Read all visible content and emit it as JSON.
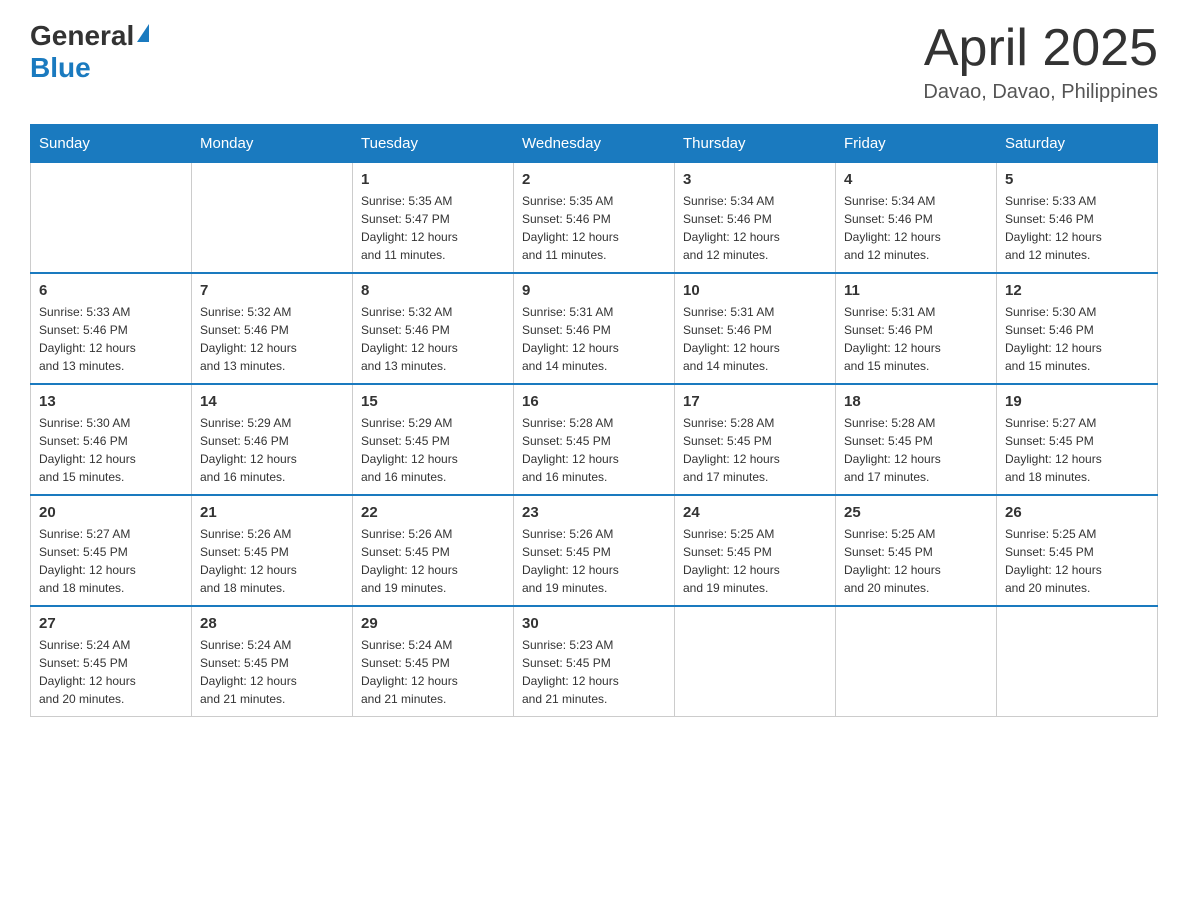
{
  "header": {
    "logo_general": "General",
    "logo_blue": "Blue",
    "month_year": "April 2025",
    "location": "Davao, Davao, Philippines"
  },
  "weekdays": [
    "Sunday",
    "Monday",
    "Tuesday",
    "Wednesday",
    "Thursday",
    "Friday",
    "Saturday"
  ],
  "weeks": [
    [
      {
        "day": "",
        "info": ""
      },
      {
        "day": "",
        "info": ""
      },
      {
        "day": "1",
        "info": "Sunrise: 5:35 AM\nSunset: 5:47 PM\nDaylight: 12 hours\nand 11 minutes."
      },
      {
        "day": "2",
        "info": "Sunrise: 5:35 AM\nSunset: 5:46 PM\nDaylight: 12 hours\nand 11 minutes."
      },
      {
        "day": "3",
        "info": "Sunrise: 5:34 AM\nSunset: 5:46 PM\nDaylight: 12 hours\nand 12 minutes."
      },
      {
        "day": "4",
        "info": "Sunrise: 5:34 AM\nSunset: 5:46 PM\nDaylight: 12 hours\nand 12 minutes."
      },
      {
        "day": "5",
        "info": "Sunrise: 5:33 AM\nSunset: 5:46 PM\nDaylight: 12 hours\nand 12 minutes."
      }
    ],
    [
      {
        "day": "6",
        "info": "Sunrise: 5:33 AM\nSunset: 5:46 PM\nDaylight: 12 hours\nand 13 minutes."
      },
      {
        "day": "7",
        "info": "Sunrise: 5:32 AM\nSunset: 5:46 PM\nDaylight: 12 hours\nand 13 minutes."
      },
      {
        "day": "8",
        "info": "Sunrise: 5:32 AM\nSunset: 5:46 PM\nDaylight: 12 hours\nand 13 minutes."
      },
      {
        "day": "9",
        "info": "Sunrise: 5:31 AM\nSunset: 5:46 PM\nDaylight: 12 hours\nand 14 minutes."
      },
      {
        "day": "10",
        "info": "Sunrise: 5:31 AM\nSunset: 5:46 PM\nDaylight: 12 hours\nand 14 minutes."
      },
      {
        "day": "11",
        "info": "Sunrise: 5:31 AM\nSunset: 5:46 PM\nDaylight: 12 hours\nand 15 minutes."
      },
      {
        "day": "12",
        "info": "Sunrise: 5:30 AM\nSunset: 5:46 PM\nDaylight: 12 hours\nand 15 minutes."
      }
    ],
    [
      {
        "day": "13",
        "info": "Sunrise: 5:30 AM\nSunset: 5:46 PM\nDaylight: 12 hours\nand 15 minutes."
      },
      {
        "day": "14",
        "info": "Sunrise: 5:29 AM\nSunset: 5:46 PM\nDaylight: 12 hours\nand 16 minutes."
      },
      {
        "day": "15",
        "info": "Sunrise: 5:29 AM\nSunset: 5:45 PM\nDaylight: 12 hours\nand 16 minutes."
      },
      {
        "day": "16",
        "info": "Sunrise: 5:28 AM\nSunset: 5:45 PM\nDaylight: 12 hours\nand 16 minutes."
      },
      {
        "day": "17",
        "info": "Sunrise: 5:28 AM\nSunset: 5:45 PM\nDaylight: 12 hours\nand 17 minutes."
      },
      {
        "day": "18",
        "info": "Sunrise: 5:28 AM\nSunset: 5:45 PM\nDaylight: 12 hours\nand 17 minutes."
      },
      {
        "day": "19",
        "info": "Sunrise: 5:27 AM\nSunset: 5:45 PM\nDaylight: 12 hours\nand 18 minutes."
      }
    ],
    [
      {
        "day": "20",
        "info": "Sunrise: 5:27 AM\nSunset: 5:45 PM\nDaylight: 12 hours\nand 18 minutes."
      },
      {
        "day": "21",
        "info": "Sunrise: 5:26 AM\nSunset: 5:45 PM\nDaylight: 12 hours\nand 18 minutes."
      },
      {
        "day": "22",
        "info": "Sunrise: 5:26 AM\nSunset: 5:45 PM\nDaylight: 12 hours\nand 19 minutes."
      },
      {
        "day": "23",
        "info": "Sunrise: 5:26 AM\nSunset: 5:45 PM\nDaylight: 12 hours\nand 19 minutes."
      },
      {
        "day": "24",
        "info": "Sunrise: 5:25 AM\nSunset: 5:45 PM\nDaylight: 12 hours\nand 19 minutes."
      },
      {
        "day": "25",
        "info": "Sunrise: 5:25 AM\nSunset: 5:45 PM\nDaylight: 12 hours\nand 20 minutes."
      },
      {
        "day": "26",
        "info": "Sunrise: 5:25 AM\nSunset: 5:45 PM\nDaylight: 12 hours\nand 20 minutes."
      }
    ],
    [
      {
        "day": "27",
        "info": "Sunrise: 5:24 AM\nSunset: 5:45 PM\nDaylight: 12 hours\nand 20 minutes."
      },
      {
        "day": "28",
        "info": "Sunrise: 5:24 AM\nSunset: 5:45 PM\nDaylight: 12 hours\nand 21 minutes."
      },
      {
        "day": "29",
        "info": "Sunrise: 5:24 AM\nSunset: 5:45 PM\nDaylight: 12 hours\nand 21 minutes."
      },
      {
        "day": "30",
        "info": "Sunrise: 5:23 AM\nSunset: 5:45 PM\nDaylight: 12 hours\nand 21 minutes."
      },
      {
        "day": "",
        "info": ""
      },
      {
        "day": "",
        "info": ""
      },
      {
        "day": "",
        "info": ""
      }
    ]
  ]
}
